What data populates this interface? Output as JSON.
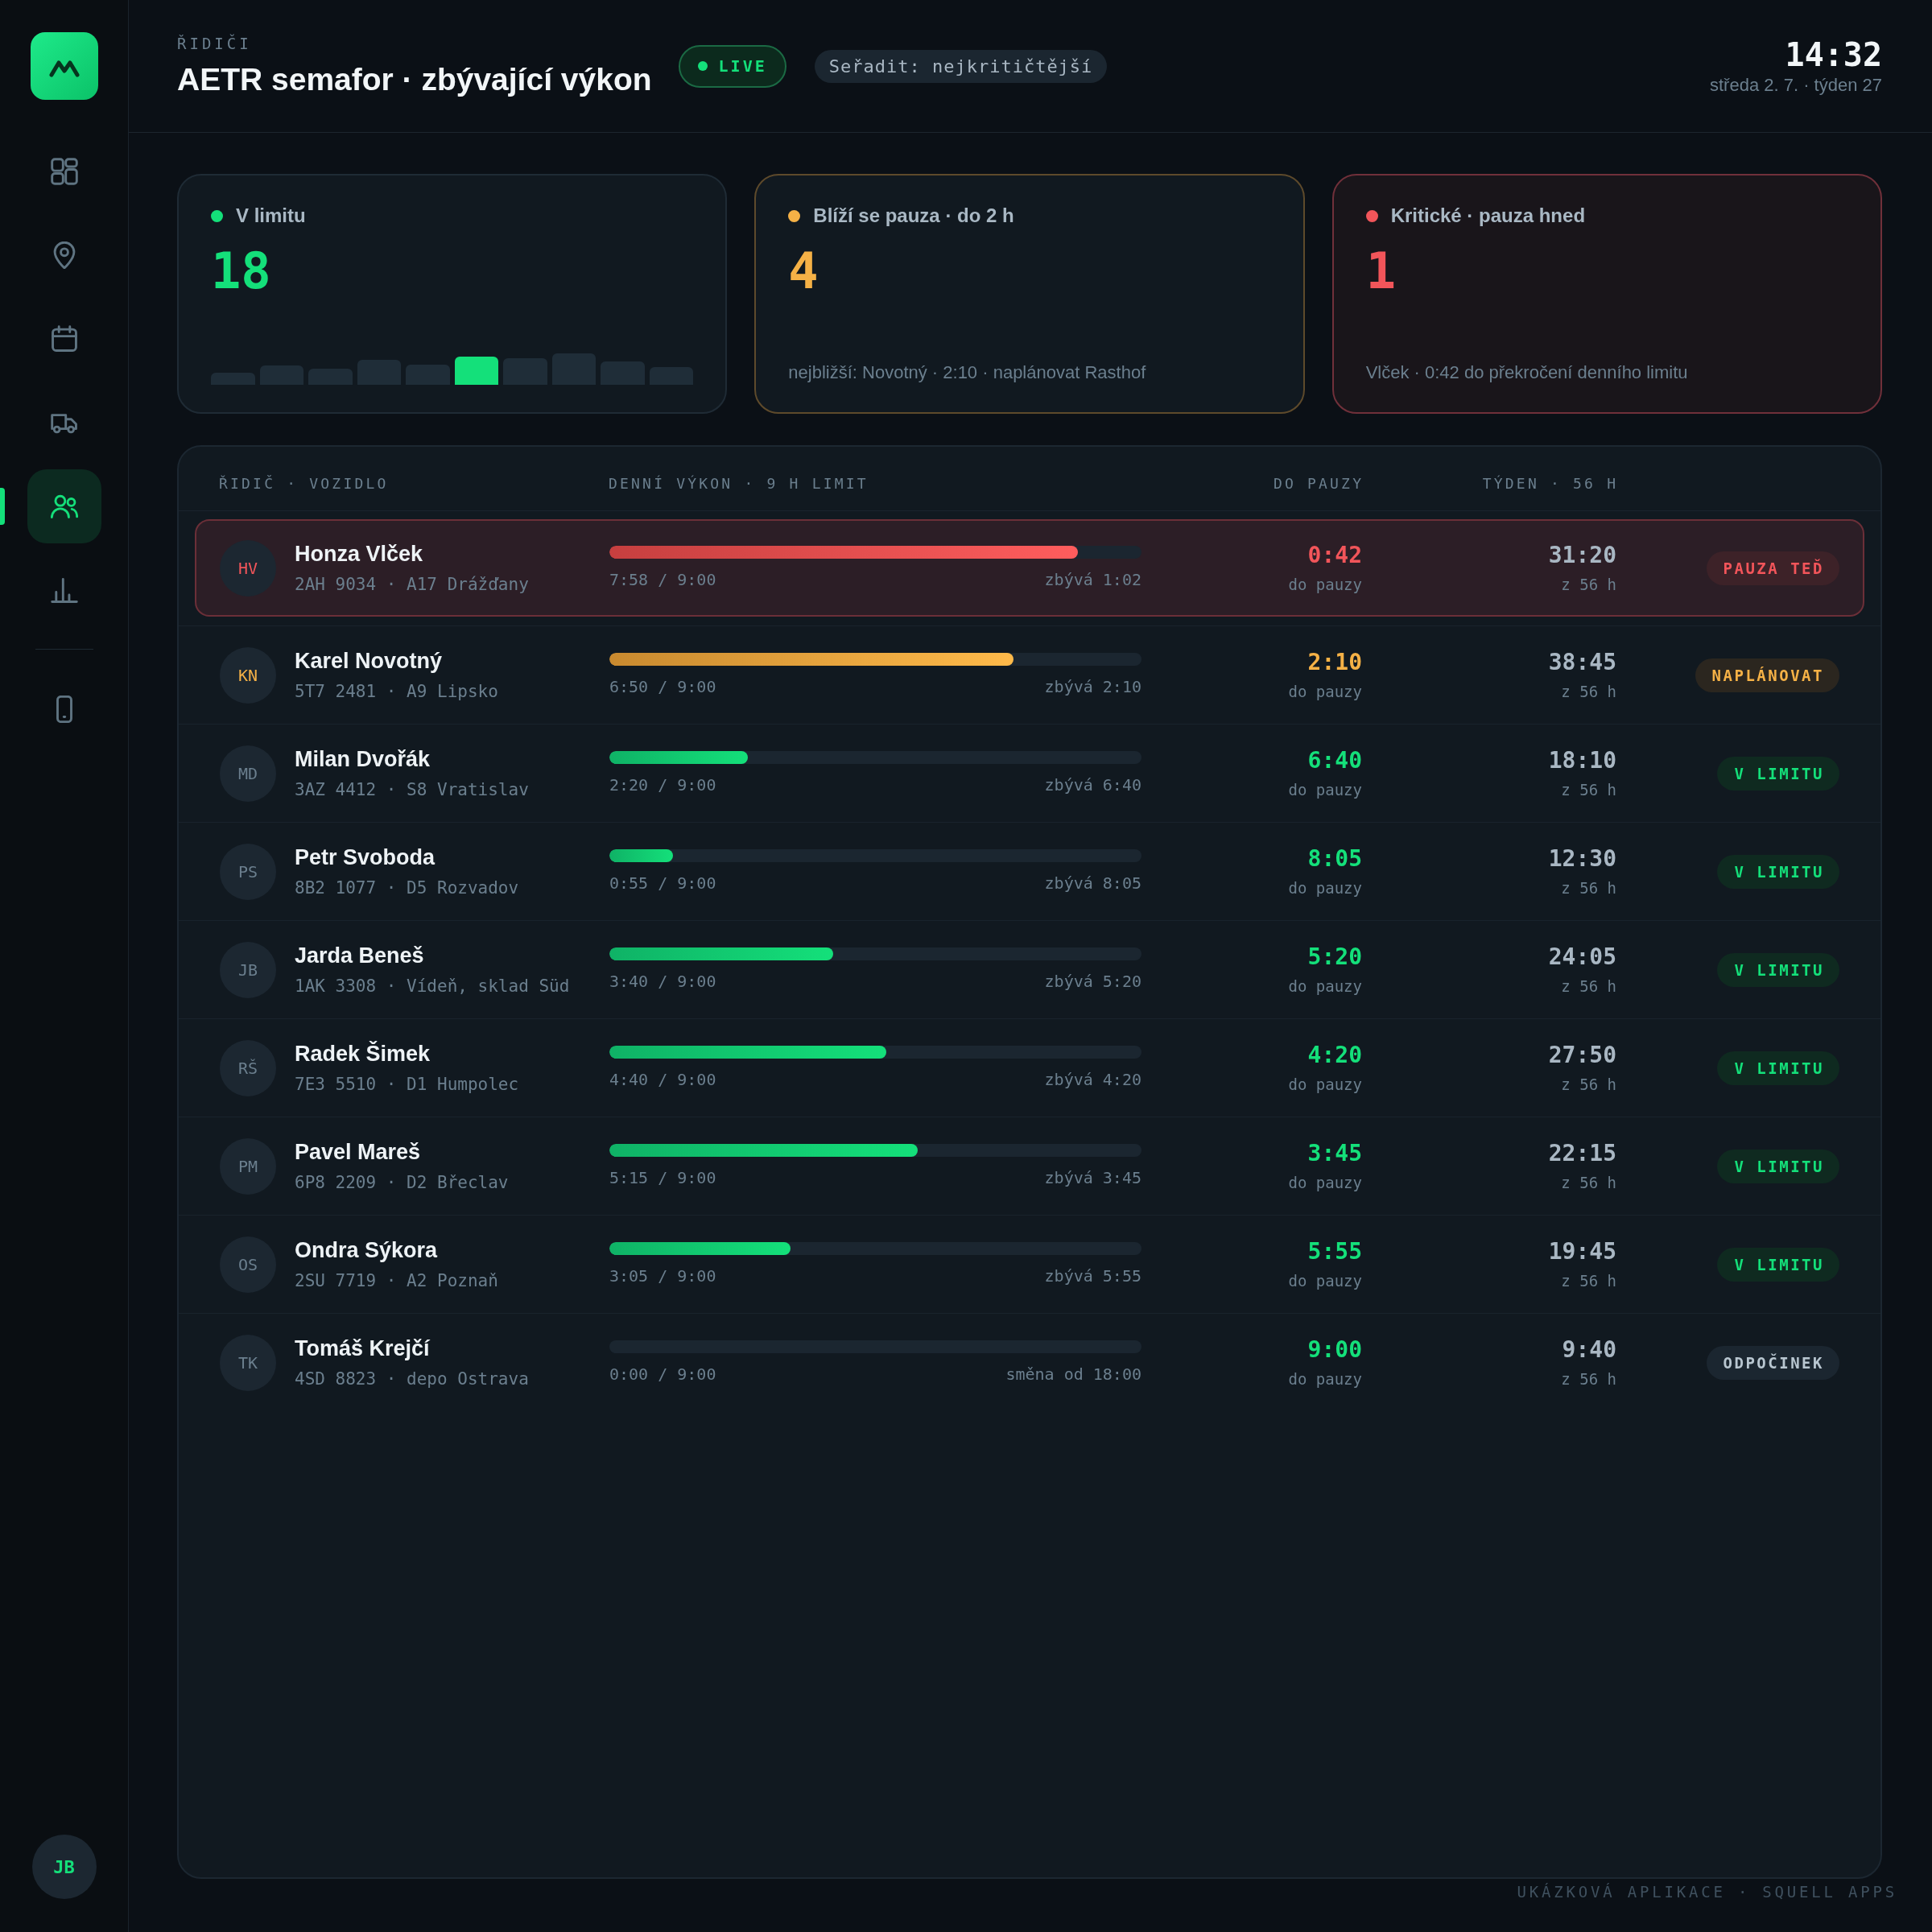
{
  "sidebar": {
    "items": [
      {
        "kind": "dashboard",
        "selected": false
      },
      {
        "kind": "map",
        "selected": false
      },
      {
        "kind": "calendar",
        "selected": false
      },
      {
        "kind": "fleet",
        "selected": false
      },
      {
        "kind": "drivers",
        "selected": true
      },
      {
        "kind": "stats",
        "selected": false
      }
    ],
    "secondary_items": [
      {
        "kind": "device",
        "selected": false
      }
    ],
    "user": {
      "initials": "JB"
    }
  },
  "header": {
    "section": "ŘIDIČI",
    "title": "AETR semafor · zbývající výkon",
    "live": {
      "label": "LIVE"
    },
    "sort": {
      "label": "Seřadit: nejkritičtější"
    },
    "clock": {
      "time": "14:32",
      "date": "středa 2. 7. · týden 27"
    }
  },
  "summary_cards": [
    {
      "kind": "ok",
      "color": "#14e07a",
      "label": "V limitu",
      "count": "18"
    },
    {
      "kind": "warning",
      "color": "#f5b146",
      "label": "Blíží se pauza · do 2 h",
      "count": "4",
      "note": "nejbližší: Novotný · 2:10 · naplánovat Rasthof"
    },
    {
      "kind": "critical",
      "color": "#f2555a",
      "label": "Kritické · pauza hned",
      "count": "1",
      "note": "Vlček · 0:42 do překročení denního limitu"
    }
  ],
  "table": {
    "columns": [
      "ŘIDIČ · VOZIDLO",
      "DENNÍ VÝKON · 9 H LIMIT",
      "DO PAUZY",
      "TÝDEN · 56 H"
    ],
    "rows": [
      {
        "kind": "critical",
        "initials": "HV",
        "name": "Honza Vlček",
        "vehicle": "2AH 9034 · A17 Drážďany",
        "level": 0.88,
        "driven": "7:58 / 9:00",
        "remaining": "zbývá 1:02",
        "to_break": "0:42",
        "to_break_label": "do pauzy",
        "week": "31:20",
        "week_label": "z 56 h",
        "badge": "PAUZA TEĎ"
      },
      {
        "kind": "warning",
        "initials": "KN",
        "name": "Karel Novotný",
        "vehicle": "5T7 2481 · A9 Lipsko",
        "level": 0.76,
        "driven": "6:50 / 9:00",
        "remaining": "zbývá 2:10",
        "to_break": "2:10",
        "to_break_label": "do pauzy",
        "week": "38:45",
        "week_label": "z 56 h",
        "badge": "NAPLÁNOVAT"
      },
      {
        "kind": "ok",
        "initials": "MD",
        "name": "Milan Dvořák",
        "vehicle": "3AZ 4412 · S8 Vratislav",
        "level": 0.26,
        "driven": "2:20 / 9:00",
        "remaining": "zbývá 6:40",
        "to_break": "6:40",
        "to_break_label": "do pauzy",
        "week": "18:10",
        "week_label": "z 56 h",
        "badge": "V LIMITU"
      },
      {
        "kind": "ok",
        "initials": "PS",
        "name": "Petr Svoboda",
        "vehicle": "8B2 1077 · D5 Rozvadov",
        "level": 0.12,
        "driven": "0:55 / 9:00",
        "remaining": "zbývá 8:05",
        "to_break": "8:05",
        "to_break_label": "do pauzy",
        "week": "12:30",
        "week_label": "z 56 h",
        "badge": "V LIMITU"
      },
      {
        "kind": "ok",
        "initials": "JB",
        "name": "Jarda Beneš",
        "vehicle": "1AK 3308 · Vídeň, sklad Süd",
        "level": 0.42,
        "driven": "3:40 / 9:00",
        "remaining": "zbývá 5:20",
        "to_break": "5:20",
        "to_break_label": "do pauzy",
        "week": "24:05",
        "week_label": "z 56 h",
        "badge": "V LIMITU"
      },
      {
        "kind": "ok",
        "initials": "RŠ",
        "name": "Radek Šimek",
        "vehicle": "7E3 5510 · D1 Humpolec",
        "level": 0.52,
        "driven": "4:40 / 9:00",
        "remaining": "zbývá 4:20",
        "to_break": "4:20",
        "to_break_label": "do pauzy",
        "week": "27:50",
        "week_label": "z 56 h",
        "badge": "V LIMITU"
      },
      {
        "kind": "ok",
        "initials": "PM",
        "name": "Pavel Mareš",
        "vehicle": "6P8 2209 · D2 Břeclav",
        "level": 0.58,
        "driven": "5:15 / 9:00",
        "remaining": "zbývá 3:45",
        "to_break": "3:45",
        "to_break_label": "do pauzy",
        "week": "22:15",
        "week_label": "z 56 h",
        "badge": "V LIMITU"
      },
      {
        "kind": "ok",
        "initials": "OS",
        "name": "Ondra Sýkora",
        "vehicle": "2SU 7719 · A2 Poznaň",
        "level": 0.34,
        "driven": "3:05 / 9:00",
        "remaining": "zbývá 5:55",
        "to_break": "5:55",
        "to_break_label": "do pauzy",
        "week": "19:45",
        "week_label": "z 56 h",
        "badge": "V LIMITU"
      },
      {
        "kind": "rest",
        "initials": "TK",
        "name": "Tomáš Krejčí",
        "vehicle": "4SD 8823 · depo Ostrava",
        "driven": "0:00 / 9:00",
        "remaining": "směna od 18:00",
        "to_break": "9:00",
        "to_break_label": "do pauzy",
        "week": "9:40",
        "week_label": "z 56 h",
        "badge": "ODPOČINEK"
      }
    ]
  },
  "footer": "UKÁZKOVÁ APLIKACE · SQUELL APPS"
}
